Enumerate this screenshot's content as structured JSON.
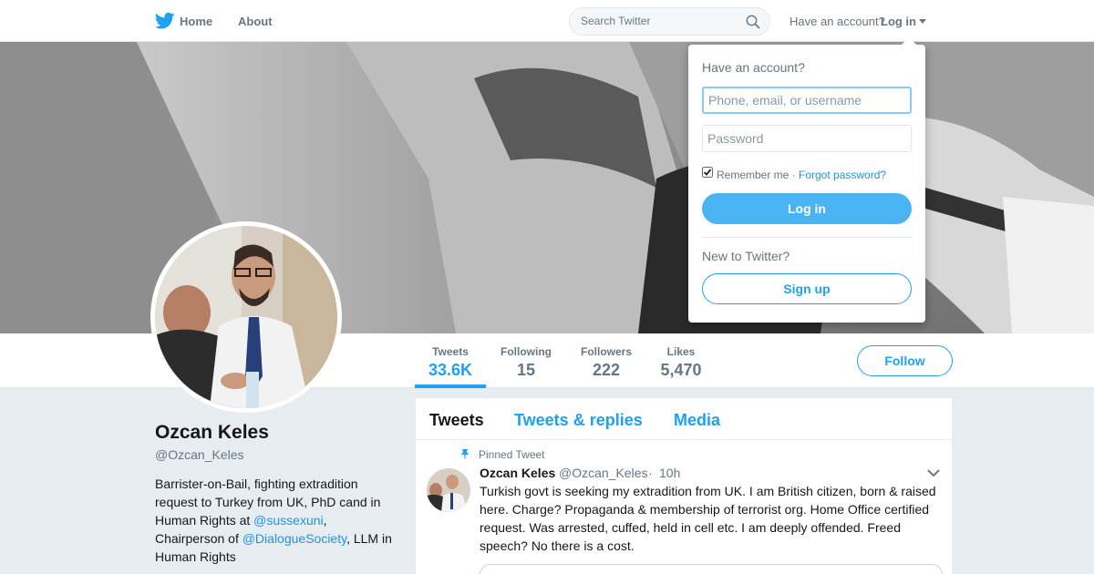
{
  "nav": {
    "logo_icon": "twitter-bird-icon",
    "home_label": "Home",
    "about_label": "About",
    "search_placeholder": "Search Twitter",
    "have_account_text": "Have an account?",
    "login_label": "Log in"
  },
  "profile": {
    "name": "Ozcan Keles",
    "handle": "@Ozcan_Keles",
    "bio": {
      "part1": "Barrister-on-Bail, fighting extradition request to Turkey from UK, PhD cand in Human Rights at ",
      "link1": "@sussexuni",
      "part2": ", Chairperson of ",
      "link2": "@DialogueSociety",
      "part3": ", LLM in Human Rights"
    },
    "follow_label": "Follow"
  },
  "stats": [
    {
      "label": "Tweets",
      "value": "33.6K"
    },
    {
      "label": "Following",
      "value": "15"
    },
    {
      "label": "Followers",
      "value": "222"
    },
    {
      "label": "Likes",
      "value": "5,470"
    }
  ],
  "timeline": {
    "tabs": [
      "Tweets",
      "Tweets & replies",
      "Media"
    ],
    "pinned_label": "Pinned Tweet",
    "tweet": {
      "name": "Ozcan Keles",
      "handle": "@Ozcan_Keles",
      "separator": "·",
      "time": "10h",
      "text": "Turkish govt is seeking my extradition from UK. I am British citizen, born & raised here. Charge? Propaganda & membership of terrorist org. Home Office certified request. Was arrested, cuffed, held in cell etc. I am deeply offended. Freed speech? No there is a cost."
    }
  },
  "login_dropdown": {
    "title": "Have an account?",
    "username_placeholder": "Phone, email, or username",
    "password_placeholder": "Password",
    "remember_text": "Remember me ·",
    "forgot_text": "Forgot password?",
    "login_button": "Log in",
    "new_text": "New to Twitter?",
    "signup_button": "Sign up"
  },
  "colors": {
    "accent": "#1da1f2",
    "background": "#e6ecf0"
  }
}
